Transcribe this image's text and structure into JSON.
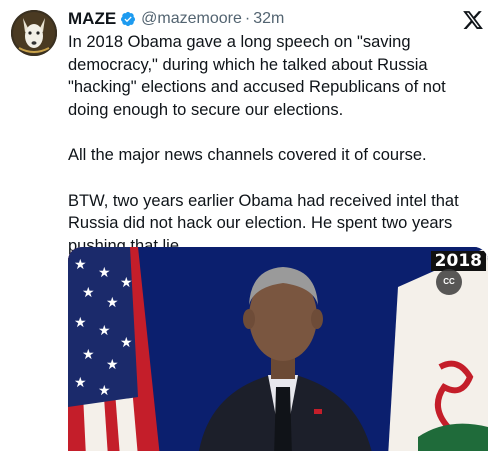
{
  "author": {
    "display_name": "MAZE",
    "handle": "@mazemoore",
    "separator": "·",
    "timestamp": "32m",
    "verified": true,
    "avatar_icon": "dog-face-avatar-icon"
  },
  "platform_icon": "x-logo-icon",
  "tweet": {
    "paragraphs": [
      "In 2018 Obama gave a long speech on \"saving democracy,\" during which he talked about Russia \"hacking\" elections and accused Republicans of not doing enough to secure our elections.",
      "All the major news channels covered it of course.",
      "BTW, two years earlier Obama had received intel that Russia did not hack our election. He spent two years pushing that lie."
    ]
  },
  "media": {
    "year_badge": "2018",
    "cc_label": "CC"
  },
  "colors": {
    "verified_blue": "#1d9bf0",
    "secondary_text": "#536471",
    "primary_text": "#0f1419",
    "background_blue": "#0b1f6e"
  }
}
